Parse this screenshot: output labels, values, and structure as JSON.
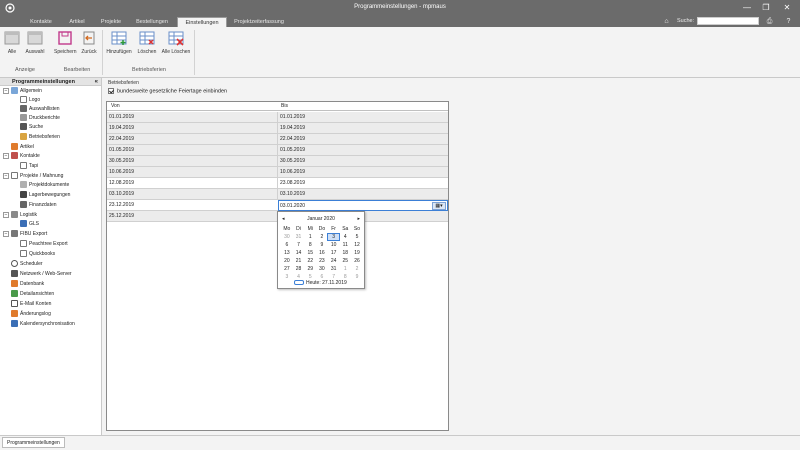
{
  "window": {
    "title": "Programmeinstellungen - mpmaus",
    "controls": [
      "—",
      "❐",
      "✕"
    ]
  },
  "tabs": [
    "Kontakte",
    "Artikel",
    "Projekte",
    "Bestellungen",
    "Einstellungen",
    "Projektzeiterfassung"
  ],
  "search": {
    "label": "Suche:",
    "value": ""
  },
  "ribbon": {
    "buttons": {
      "alle": "Alle",
      "auswahl": "Auswahl",
      "speichern": "Speichern",
      "zurueck": "Zurück",
      "hinzufuegen": "Hinzufügen",
      "loeschen": "Löschen",
      "alle_loeschen": "Alle Löschen"
    },
    "groups": {
      "anzeige": "Anzeige",
      "bearbeiten": "Bearbeiten",
      "betriebsferien": "Betriebsferien"
    }
  },
  "sidebar": {
    "header": "Programmeinstellungen",
    "collapse": "«",
    "items": [
      "Allgemein",
      "Logo",
      "Auswahllisten",
      "Druckberichte",
      "Suche",
      "Betriebsferien",
      "Artikel",
      "Kontakte",
      "Tapi",
      "Projekte / Mahnung",
      "Projektdokumente",
      "Lagerbewegungen",
      "Finanzdaten",
      "Logistik",
      "GLS",
      "FIBU Export",
      "Peachtree Export",
      "Quickbooks",
      "Scheduler",
      "Netzwerk / Web-Server",
      "Datenbank",
      "Detailansichten",
      "E-Mail Konten",
      "Änderungslog",
      "Kalendersynchronisation"
    ]
  },
  "content": {
    "section_title": "Betriebsferien",
    "checkbox_label": "bundesweite gesetzliche Feiertage einbinden",
    "checkbox_checked": true,
    "col_von": "Von",
    "col_bis": "Bis",
    "rows": [
      [
        "01.01.2019",
        "01.01.2019"
      ],
      [
        "19.04.2019",
        "19.04.2019"
      ],
      [
        "22.04.2019",
        "22.04.2019"
      ],
      [
        "01.05.2019",
        "01.05.2019"
      ],
      [
        "30.05.2019",
        "30.05.2019"
      ],
      [
        "10.06.2019",
        "10.06.2019"
      ],
      [
        "12.08.2019",
        "23.08.2019"
      ],
      [
        "03.10.2019",
        "03.10.2019"
      ],
      [
        "23.12.2019",
        "03.01.2020"
      ],
      [
        "25.12.2019",
        ""
      ]
    ]
  },
  "calendar": {
    "month": "Januar 2020",
    "prev": "◂",
    "next": "▸",
    "weekdays": [
      "Mo",
      "Di",
      "Mi",
      "Do",
      "Fr",
      "Sa",
      "So"
    ],
    "weeks": [
      [
        "30",
        "31",
        "1",
        "2",
        "3",
        "4",
        "5"
      ],
      [
        "6",
        "7",
        "8",
        "9",
        "10",
        "11",
        "12"
      ],
      [
        "13",
        "14",
        "15",
        "16",
        "17",
        "18",
        "19"
      ],
      [
        "20",
        "21",
        "22",
        "23",
        "24",
        "25",
        "26"
      ],
      [
        "27",
        "28",
        "29",
        "30",
        "31",
        "1",
        "2"
      ],
      [
        "3",
        "4",
        "5",
        "6",
        "7",
        "8",
        "9"
      ]
    ],
    "today_label": "Heute: 27.11.2019",
    "selected_day": "3"
  },
  "statusbar": {
    "tab": "Programmeinstellungen"
  }
}
